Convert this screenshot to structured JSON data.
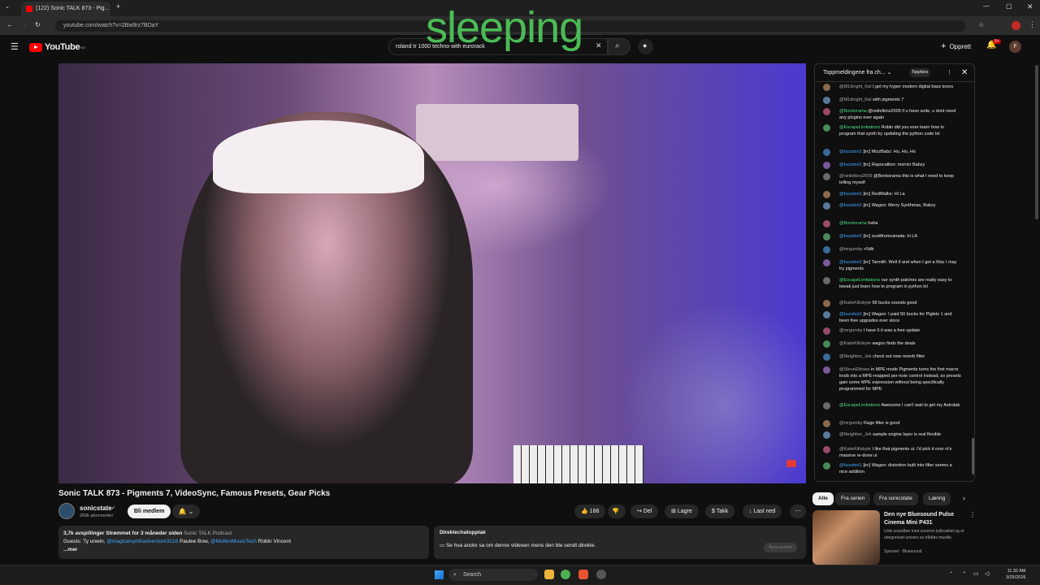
{
  "browser": {
    "tab_title": "(122) Sonic TALK 873 - Pig...",
    "url": "youtube.com/watch?v=2Bw9rz7BDaY",
    "overlay_text": "sleeping"
  },
  "header": {
    "logo_text": "YouTube",
    "logo_country": "NO",
    "search_value": "roland tr 1000 techno with eurorack",
    "create_label": "Opprett",
    "notifications_badge": "9+",
    "avatar_letter": "F"
  },
  "video": {
    "title": "Sonic TALK 873 - Pigments 7, VideoSync, Famous Presets, Gear Picks"
  },
  "channel": {
    "name": "sonicstate",
    "subscribers": "260k abonnenter",
    "member_label": "Bli medlem"
  },
  "actions": {
    "likes": "166",
    "share": "Del",
    "save": "Lagre",
    "thanks": "Takk",
    "download": "Last ned"
  },
  "description": {
    "meta": "3,7k avspillinger  Strømmet for 3 måneder siden",
    "podcast": "Sonic TALK Podcast",
    "guests_prefix": "Guests: Ty unwin,",
    "guest_link1": "@magicalsynthadventure3216",
    "guest_mid": "Paulee Bow,",
    "guest_link2": "@MoltenMusicTech",
    "guest_end": "Robin Vincent",
    "more": "...mer"
  },
  "replay": {
    "title": "Direktechatopptak",
    "text": "Se hva andre sa om denne videoen mens den ble sendt direkte.",
    "button": "Åpne panelet"
  },
  "chat": {
    "header": "Toppmeldingene fra ch...",
    "top_badge": "Toppfans",
    "messages": [
      {
        "author": "@M1dnight_0wl",
        "text": "I get my hyper modern digital bass tones"
      },
      {
        "author": "@M1dnight_0wl",
        "text": "with pigments 7"
      },
      {
        "author": "@Bonkorama",
        "text": "@neilelkins2009 if u have suite, u dont need any plugins ever again"
      },
      {
        "author": "@EscapeLimitations",
        "text": "Robin did you ever learn how to program that synth by updating the python code lol"
      },
      {
        "author": "@buzzbot1",
        "text": "[irc] MizzBabz: Ho, Ho, Ho"
      },
      {
        "author": "@buzzbot1",
        "text": "[irc] Rapocallion: mornin Babzy"
      },
      {
        "author": "@neilelkins2009",
        "text": "@Bonkorama this is what I need to keep telling myself"
      },
      {
        "author": "@buzzbot1",
        "text": "[irc] RedWalks: Hi La"
      },
      {
        "author": "@buzzbot1",
        "text": "[irc] Wagoo: Merry Synthmas, Babzy"
      },
      {
        "author": "@Bonkorama",
        "text": "haha"
      },
      {
        "author": "@buzzbot1",
        "text": "[irc] scottfromcanada: hi LA"
      },
      {
        "author": "@mrgumby",
        "text": "+5db"
      },
      {
        "author": "@buzzbot1",
        "text": "[irc] Tannith: Well if and when I get a Mac I may try pigments"
      },
      {
        "author": "@EscapeLimitations",
        "text": "our synth patches are really easy to tweak just learn how to program in python lol"
      },
      {
        "author": "@KatieKillobyte",
        "text": "99 bucks sounds good"
      },
      {
        "author": "@buzzbot1",
        "text": "[irc] Wagoo: I paid 50 bucks for Piglets 1 and been free upgrades ever since"
      },
      {
        "author": "@mrgumby",
        "text": "I have 6 it was a free update"
      },
      {
        "author": "@KatieKillobyte",
        "text": "wagoo finds the deals"
      },
      {
        "author": "@Neighbor_Jek",
        "text": "check out new reverb filter"
      },
      {
        "author": "@SteveElbows",
        "text": "in MPE mode Pigments turns the first macro knob into a MPE-mapped per-note control instead, so presets gain some MPE expression without being specifically programmed for MPE"
      },
      {
        "author": "@EscapeLimitations",
        "text": "Awesome I can't wait to get my Astrolab"
      },
      {
        "author": "@mrgumby",
        "text": "Rage filter is good"
      },
      {
        "author": "@Neighbor_Jek",
        "text": "sample engine layer is real flexible"
      },
      {
        "author": "@KatieKillobyte",
        "text": "I like that pigments ui. I'd pick it over ni's massive re-done ui"
      },
      {
        "author": "@buzzbot1",
        "text": "[irc] Wagoo: distortion built into filter seems a nice addition"
      }
    ]
  },
  "chips": [
    "Alle",
    "Fra serien",
    "Fra sonicstate",
    "Læring"
  ],
  "ad": {
    "title": "Den nye Bluesound Pulse Cinema Mini P431",
    "desc": "Unik soundbar med suveren lydkvalitet og et ubegrenset univers av trådløs musikk.",
    "sponsor": "Sponset · Bluesound"
  },
  "taskbar": {
    "search": "Search",
    "time": "11:32 AM",
    "date": "3/25/2026"
  }
}
